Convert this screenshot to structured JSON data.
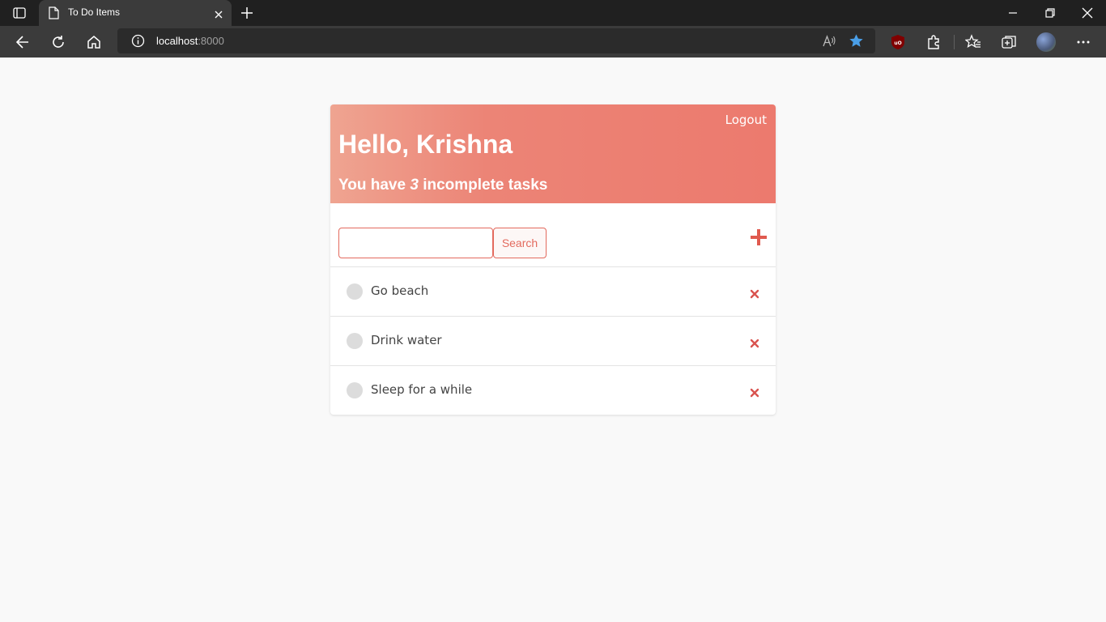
{
  "browser": {
    "tab_title": "To Do Items",
    "url_host": "localhost",
    "url_port": ":8000"
  },
  "header": {
    "logout_label": "Logout",
    "greeting": "Hello, Krishna",
    "summary_prefix": "You have ",
    "incomplete_count": "3",
    "summary_suffix": " incomplete tasks"
  },
  "search": {
    "value": "",
    "button_label": "Search"
  },
  "tasks": [
    {
      "label": "Go beach"
    },
    {
      "label": "Drink water"
    },
    {
      "label": "Sleep for a while"
    }
  ],
  "colors": {
    "accent": "#e36a5e",
    "header_gradient_start": "#efa491",
    "header_gradient_end": "#ec7a6e",
    "delete": "#d9534f"
  }
}
